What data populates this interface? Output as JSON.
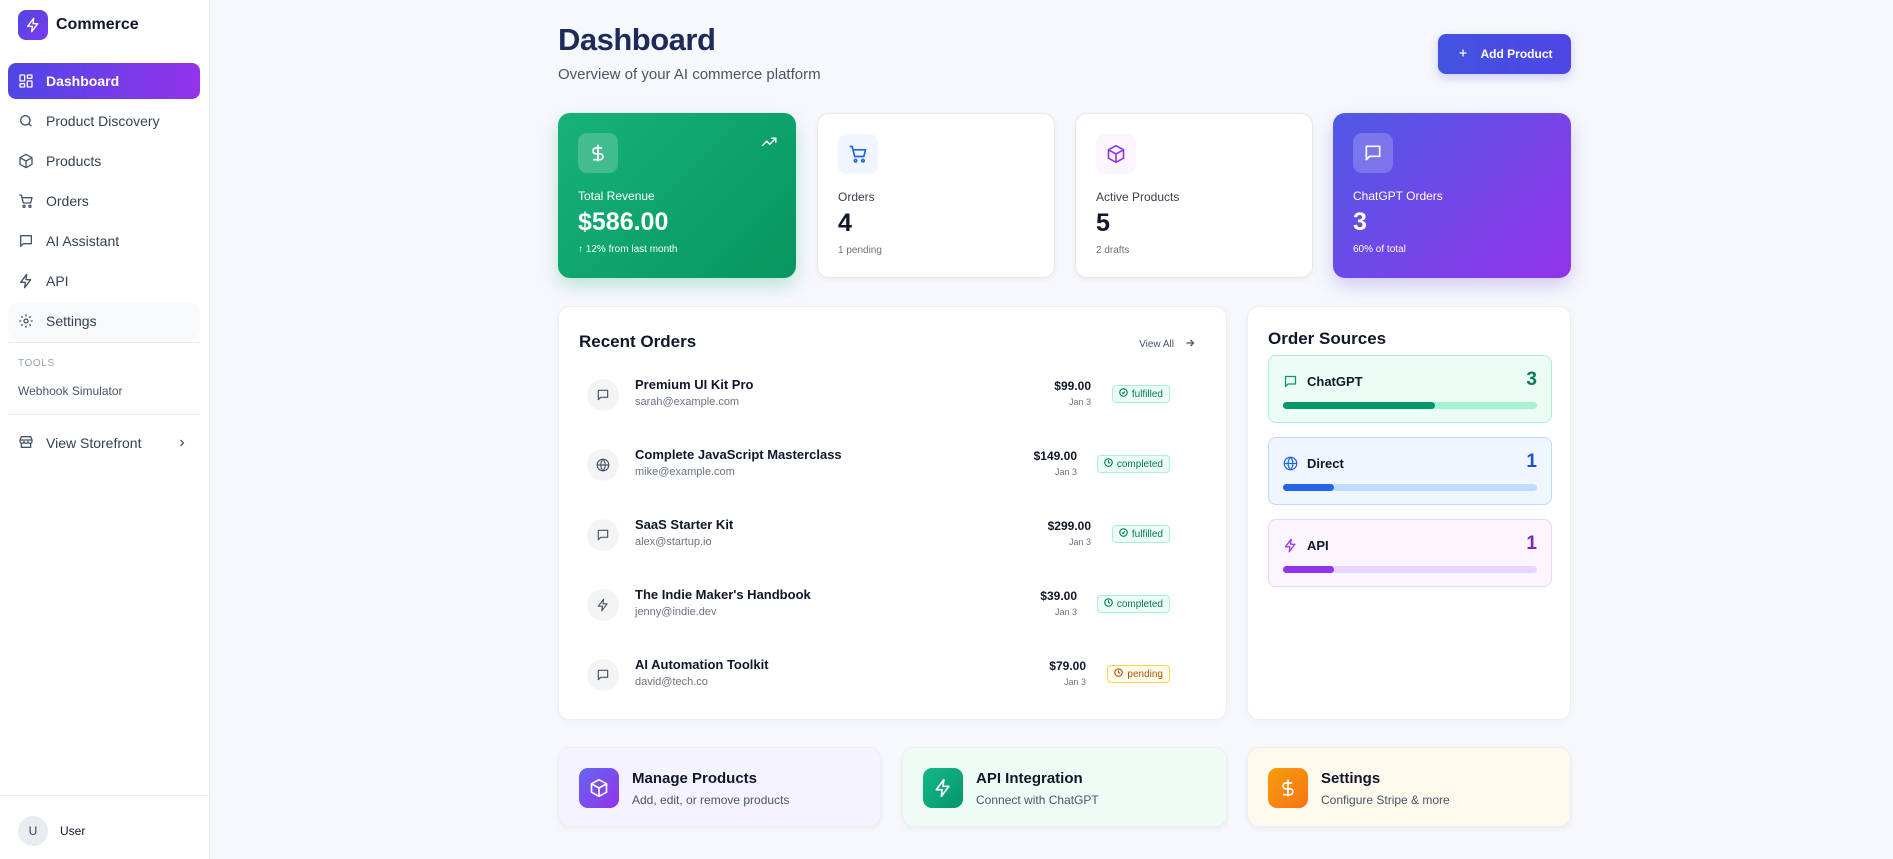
{
  "brand": {
    "name": "Commerce"
  },
  "sidebar": {
    "items": [
      {
        "label": "Dashboard",
        "icon": "dashboard-grid-icon"
      },
      {
        "label": "Product Discovery",
        "icon": "search-icon"
      },
      {
        "label": "Products",
        "icon": "package-icon"
      },
      {
        "label": "Orders",
        "icon": "cart-icon"
      },
      {
        "label": "AI Assistant",
        "icon": "message-icon"
      },
      {
        "label": "API",
        "icon": "lightning-icon"
      },
      {
        "label": "Settings",
        "icon": "gear-icon"
      }
    ],
    "tools_label": "TOOLS",
    "tools_link": "Webhook Simulator",
    "storefront": "View Storefront",
    "user": {
      "initial": "U",
      "name": "User"
    }
  },
  "header": {
    "title": "Dashboard",
    "subtitle": "Overview of your AI commerce platform",
    "add_button": "Add Product"
  },
  "stats": [
    {
      "label": "Total Revenue",
      "value": "$586.00",
      "note": "↑ 12% from last month"
    },
    {
      "label": "Orders",
      "value": "4",
      "note": "1 pending"
    },
    {
      "label": "Active Products",
      "value": "5",
      "note": "2 drafts"
    },
    {
      "label": "ChatGPT Orders",
      "value": "3",
      "note": "60% of total"
    }
  ],
  "recent_orders": {
    "title": "Recent Orders",
    "view_all": "View All",
    "rows": [
      {
        "name": "Premium UI Kit Pro",
        "email": "sarah@example.com",
        "price": "$99.00",
        "date": "Jan 3",
        "status": "fulfilled",
        "source_icon": "message-icon"
      },
      {
        "name": "Complete JavaScript Masterclass",
        "email": "mike@example.com",
        "price": "$149.00",
        "date": "Jan 3",
        "status": "completed",
        "source_icon": "globe-icon"
      },
      {
        "name": "SaaS Starter Kit",
        "email": "alex@startup.io",
        "price": "$299.00",
        "date": "Jan 3",
        "status": "fulfilled",
        "source_icon": "message-icon"
      },
      {
        "name": "The Indie Maker's Handbook",
        "email": "jenny@indie.dev",
        "price": "$39.00",
        "date": "Jan 3",
        "status": "completed",
        "source_icon": "lightning-icon"
      },
      {
        "name": "AI Automation Toolkit",
        "email": "david@tech.co",
        "price": "$79.00",
        "date": "Jan 3",
        "status": "pending",
        "source_icon": "message-icon"
      }
    ]
  },
  "order_sources": {
    "title": "Order Sources",
    "items": [
      {
        "name": "ChatGPT",
        "count": "3",
        "fraction": 0.6,
        "color": "#059669",
        "icon": "message-icon"
      },
      {
        "name": "Direct",
        "count": "1",
        "fraction": 0.2,
        "color": "#2563eb",
        "icon": "globe-icon"
      },
      {
        "name": "API",
        "count": "1",
        "fraction": 0.2,
        "color": "#9333ea",
        "icon": "lightning-icon"
      }
    ]
  },
  "quick_links": [
    {
      "title": "Manage Products",
      "subtitle": "Add, edit, or remove products",
      "icon": "package-icon"
    },
    {
      "title": "API Integration",
      "subtitle": "Connect with ChatGPT",
      "icon": "lightning-icon"
    },
    {
      "title": "Settings",
      "subtitle": "Configure Stripe & more",
      "icon": "dollar-icon"
    }
  ],
  "colors": {
    "accent": "#4f46e5",
    "accent_purple": "#9333ea",
    "revenue_green": "#10a572",
    "pending_amber": "#b45309"
  }
}
